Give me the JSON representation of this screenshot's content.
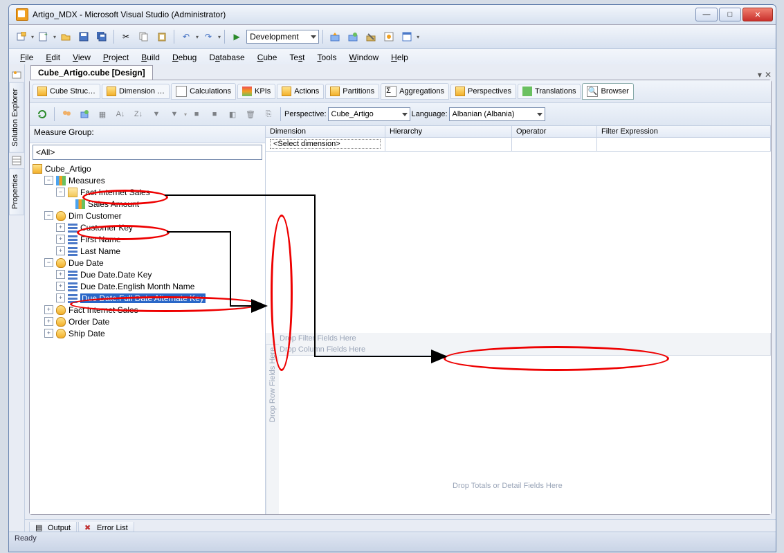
{
  "window": {
    "title": "Artigo_MDX - Microsoft Visual Studio (Administrator)"
  },
  "toolbar": {
    "config_label": "Development"
  },
  "menu": {
    "file": "File",
    "edit": "Edit",
    "view": "View",
    "project": "Project",
    "build": "Build",
    "debug": "Debug",
    "database": "Database",
    "cube": "Cube",
    "test": "Test",
    "tools": "Tools",
    "window": "Window",
    "help": "Help"
  },
  "sidetabs": {
    "a": "Solution Explorer",
    "b": "Properties"
  },
  "doc_tab": "Cube_Artigo.cube [Design]",
  "cubetabs": {
    "struc": "Cube Struc…",
    "dim": "Dimension …",
    "calc": "Calculations",
    "kpi": "KPIs",
    "act": "Actions",
    "part": "Partitions",
    "agg": "Aggregations",
    "persp": "Perspectives",
    "trans": "Translations",
    "brow": "Browser"
  },
  "subbar": {
    "persp_label": "Perspective:",
    "persp_value": "Cube_Artigo",
    "lang_label": "Language:",
    "lang_value": "Albanian (Albania)"
  },
  "measure_group": {
    "label": "Measure Group:",
    "value": "<All>"
  },
  "tree": {
    "root": "Cube_Artigo",
    "measures": "Measures",
    "fis_folder": "Fact Internet Sales",
    "sales_amount": "Sales Amount",
    "dim_customer": "Dim Customer",
    "cust_key": "Customer Key",
    "first_name": "First Name",
    "last_name": "Last Name",
    "due_date": "Due Date",
    "dd_datekey": "Due Date.Date Key",
    "dd_month": "Due Date.English Month Name",
    "dd_full": "Due Date.Full Date Alternate Key",
    "fis_dim": "Fact Internet Sales",
    "order_date": "Order Date",
    "ship_date": "Ship Date"
  },
  "filter_grid": {
    "dim": "Dimension",
    "hier": "Hierarchy",
    "op": "Operator",
    "expr": "Filter Expression",
    "select": "<Select dimension>"
  },
  "pivot": {
    "filter": "Drop Filter Fields Here",
    "col": "Drop Column Fields Here",
    "row": "Drop Row Fields Here",
    "data": "Drop Totals or Detail Fields Here"
  },
  "bottom_tabs": {
    "output": "Output",
    "errors": "Error List"
  },
  "status": "Ready"
}
